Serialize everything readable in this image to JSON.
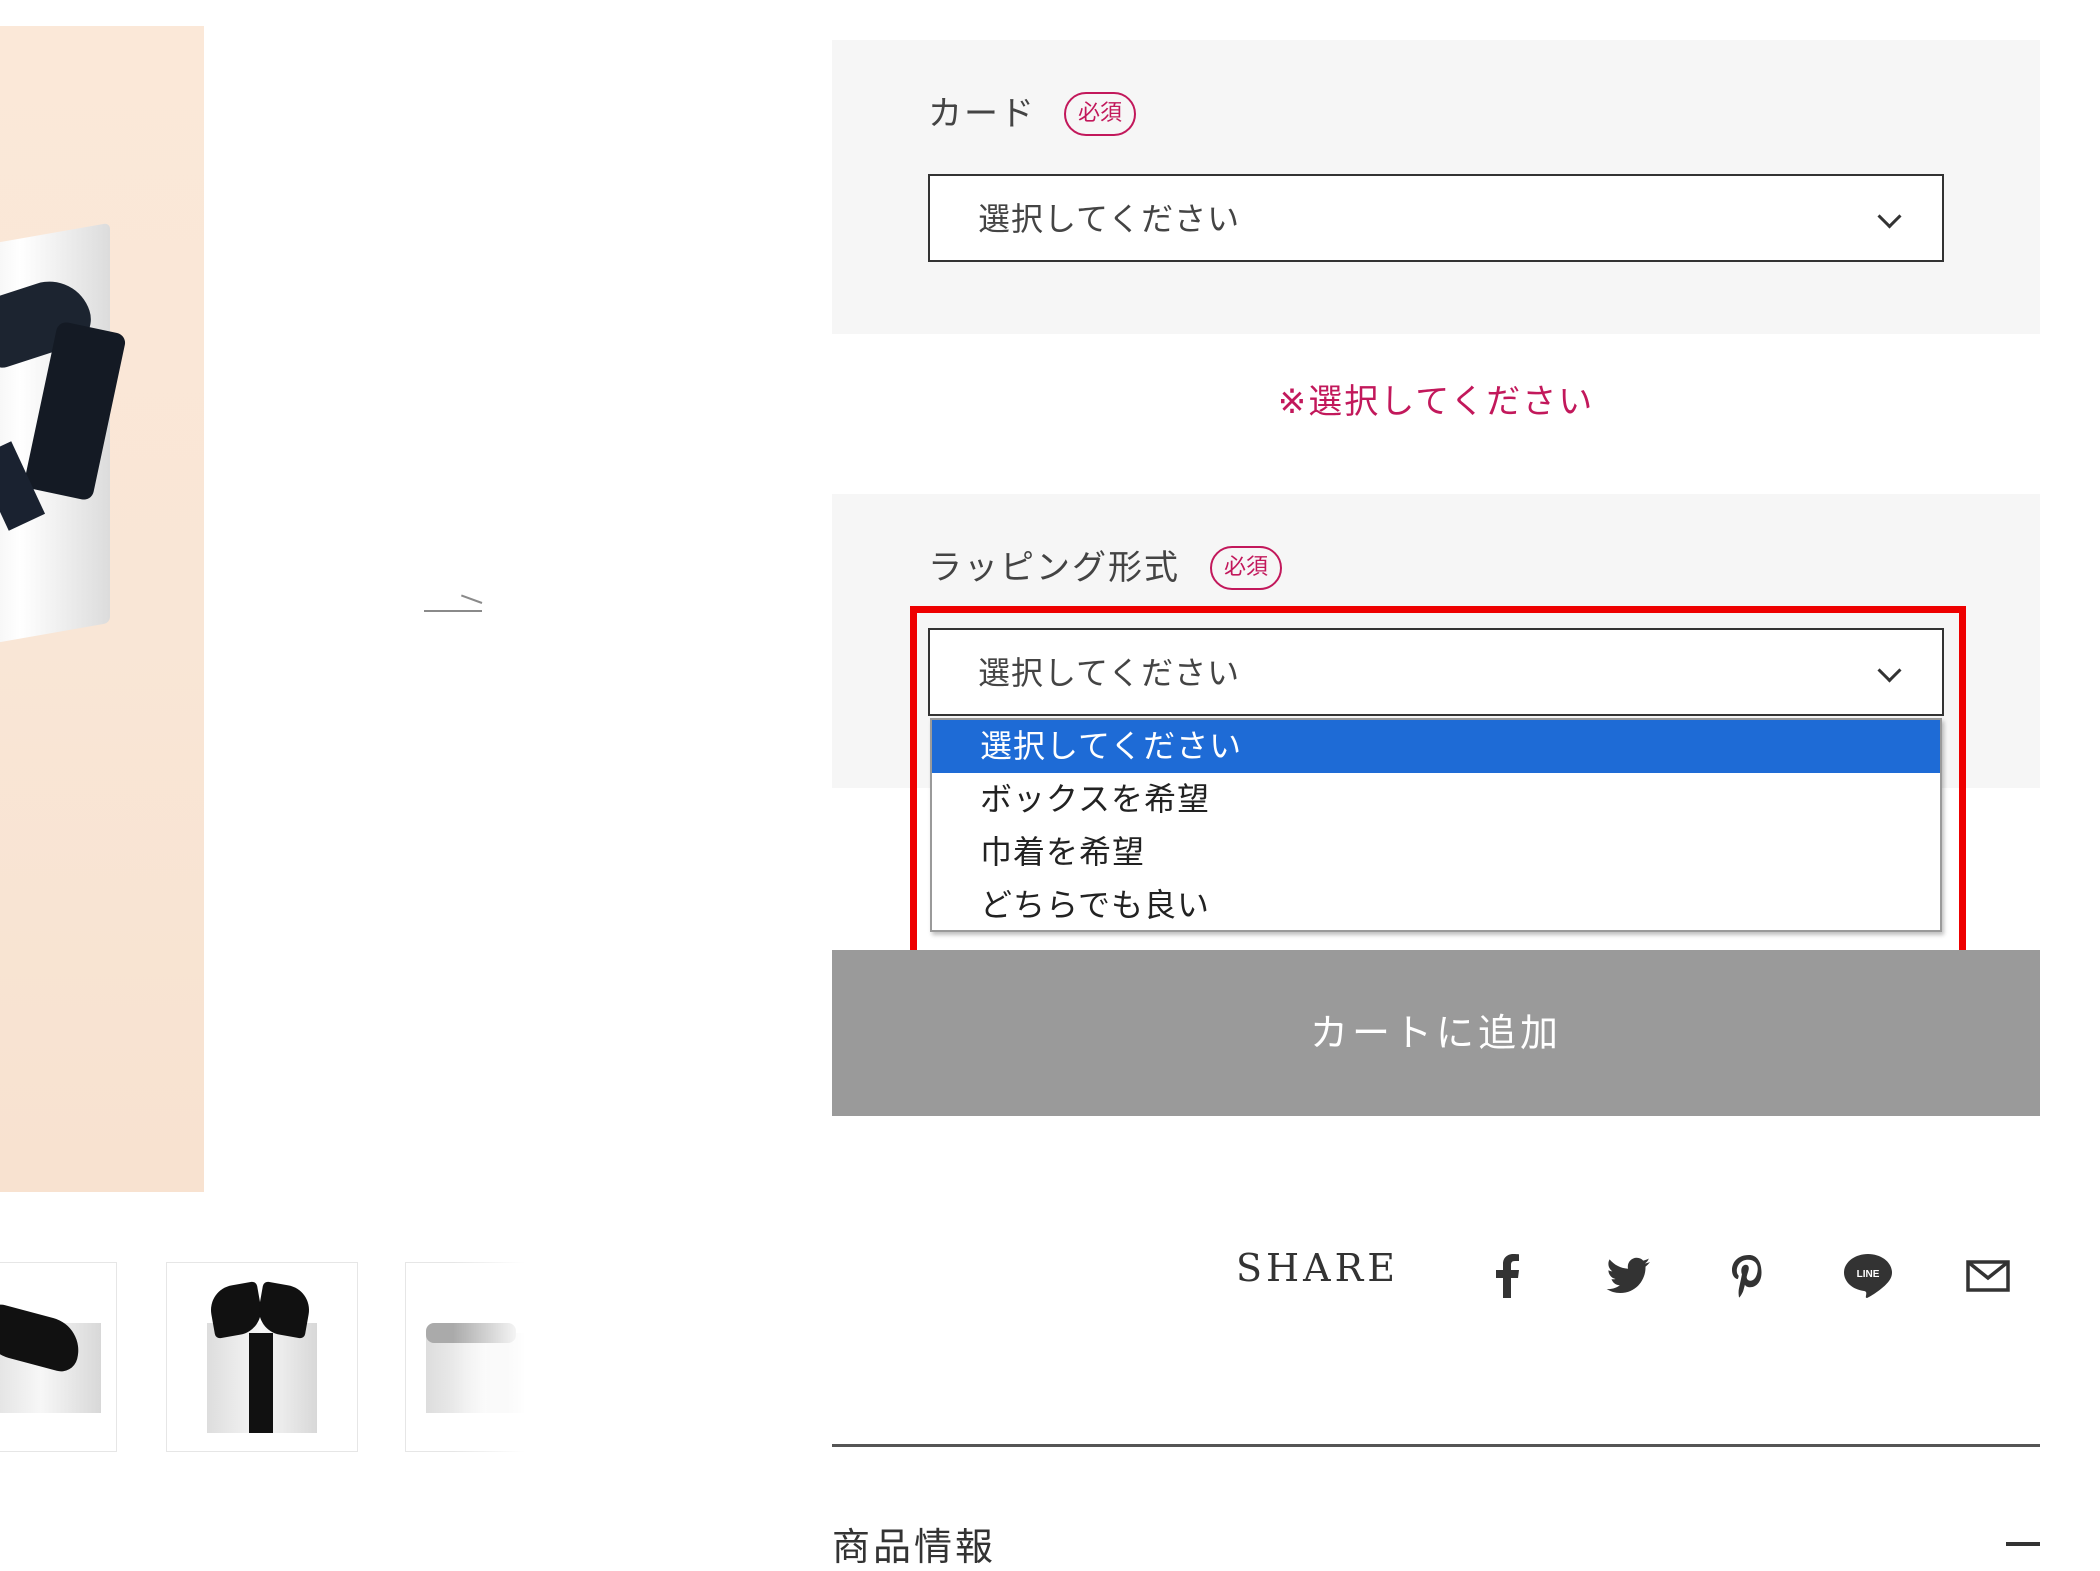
{
  "card_option": {
    "label": "カード",
    "required_badge": "必須",
    "select_value": "選択してください",
    "error": "※選択してください"
  },
  "wrapping_option": {
    "label": "ラッピング形式",
    "required_badge": "必須",
    "select_value": "選択してください",
    "options": [
      {
        "label": "選択してください",
        "selected": true
      },
      {
        "label": "ボックスを希望",
        "selected": false
      },
      {
        "label": "巾着を希望",
        "selected": false
      },
      {
        "label": "どちらでも良い",
        "selected": false
      }
    ]
  },
  "cart_button_label": "カートに追加",
  "share": {
    "label": "SHARE",
    "icons": [
      "facebook-icon",
      "twitter-icon",
      "pinterest-icon",
      "line-icon",
      "mail-icon"
    ]
  },
  "product_info_title": "商品情報",
  "colors": {
    "accent_required": "#c2185b",
    "option_highlight": "#1e6bd6",
    "cart_button": "#9a9a9a",
    "annotation_frame": "#ee0000"
  }
}
